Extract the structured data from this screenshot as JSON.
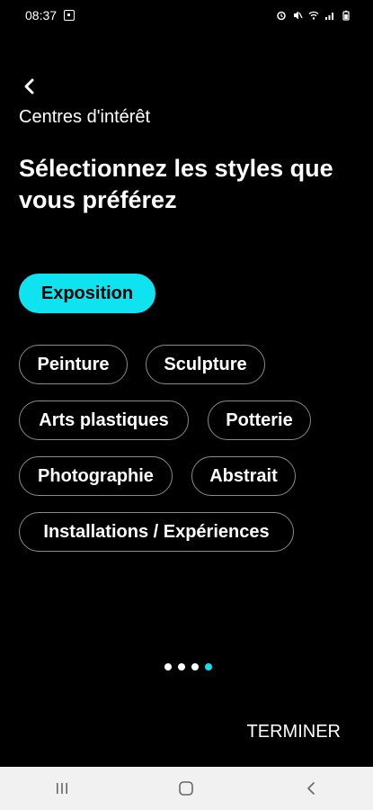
{
  "status_bar": {
    "time": "08:37",
    "icons": [
      "notification-icon",
      "alarm-icon",
      "mute-icon",
      "wifi-icon",
      "signal-icon",
      "battery-icon"
    ]
  },
  "header": {
    "back_icon": "chevron-left-icon",
    "subtitle": "Centres d'intérêt",
    "title": "Sélectionnez les styles que vous préférez"
  },
  "chips": [
    {
      "label": "Exposition",
      "selected": true
    },
    {
      "label": "Peinture",
      "selected": false
    },
    {
      "label": "Sculpture",
      "selected": false
    },
    {
      "label": "Arts plastiques",
      "selected": false
    },
    {
      "label": "Potterie",
      "selected": false
    },
    {
      "label": "Photographie",
      "selected": false
    },
    {
      "label": "Abstrait",
      "selected": false
    },
    {
      "label": "Installations / Expériences",
      "selected": false
    }
  ],
  "pager": {
    "count": 4,
    "active_index": 3
  },
  "footer": {
    "finish_label": "TERMINER"
  },
  "nav_bar": {
    "icons": [
      "recent-apps-icon",
      "home-icon",
      "back-icon"
    ]
  },
  "colors": {
    "accent": "#0fe3f0",
    "background": "#000000",
    "navbar": "#f1f1f1"
  }
}
